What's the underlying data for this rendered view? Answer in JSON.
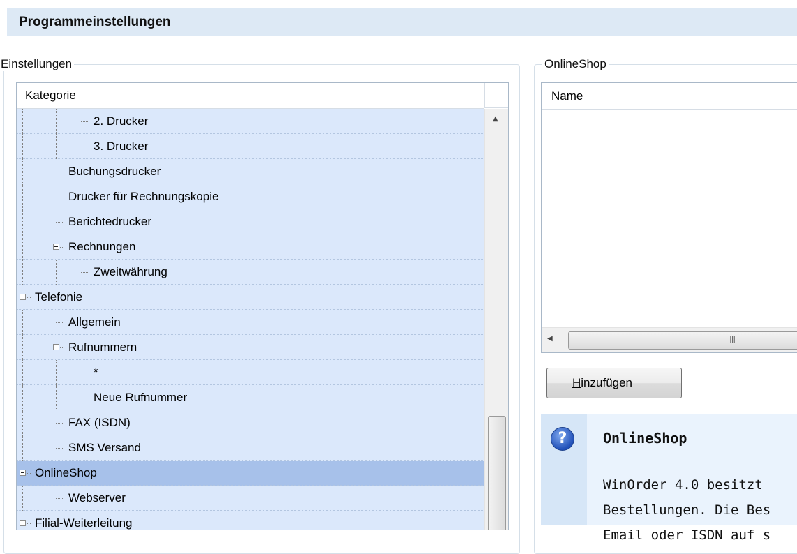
{
  "window": {
    "title": "Programmeinstellungen"
  },
  "settings_group": {
    "legend": "Einstellungen"
  },
  "tree": {
    "column_header": "Kategorie",
    "rows": [
      {
        "label": "2. Drucker",
        "level": 3,
        "selected": false
      },
      {
        "label": "3. Drucker",
        "level": 3,
        "selected": false
      },
      {
        "label": "Buchungsdrucker",
        "level": 2,
        "selected": false
      },
      {
        "label": "Drucker für Rechnungskopie",
        "level": 2,
        "selected": false
      },
      {
        "label": "Berichtedrucker",
        "level": 2,
        "selected": false
      },
      {
        "label": "Rechnungen",
        "level": 2,
        "selected": false,
        "expander": true
      },
      {
        "label": "Zweitwährung",
        "level": 3,
        "selected": false
      },
      {
        "label": "Telefonie",
        "level": 1,
        "selected": false,
        "expander": true
      },
      {
        "label": "Allgemein",
        "level": 2,
        "selected": false
      },
      {
        "label": "Rufnummern",
        "level": 2,
        "selected": false,
        "expander": true
      },
      {
        "label": "*",
        "level": 3,
        "selected": false
      },
      {
        "label": "Neue Rufnummer",
        "level": 3,
        "selected": false
      },
      {
        "label": "FAX (ISDN)",
        "level": 2,
        "selected": false
      },
      {
        "label": "SMS Versand",
        "level": 2,
        "selected": false
      },
      {
        "label": "OnlineShop",
        "level": 1,
        "selected": true,
        "expander": true
      },
      {
        "label": "Webserver",
        "level": 2,
        "selected": false
      },
      {
        "label": "Filial-Weiterleitung",
        "level": 1,
        "selected": false,
        "expander": true
      }
    ]
  },
  "onlineshop_group": {
    "legend": "OnlineShop"
  },
  "list": {
    "column_header": "Name"
  },
  "add_button": {
    "mnemonic": "H",
    "rest": "inzufügen"
  },
  "help": {
    "title": "OnlineShop",
    "lines": [
      "WinOrder 4.0 besitzt",
      "Bestellungen. Die Bes",
      "Email oder ISDN auf s"
    ]
  },
  "colors": {
    "title_bar": "#dde9f5",
    "tree_background": "#dbe8fb",
    "selected_row": "#a7c1ea",
    "help_background": "#eaf3fd"
  }
}
